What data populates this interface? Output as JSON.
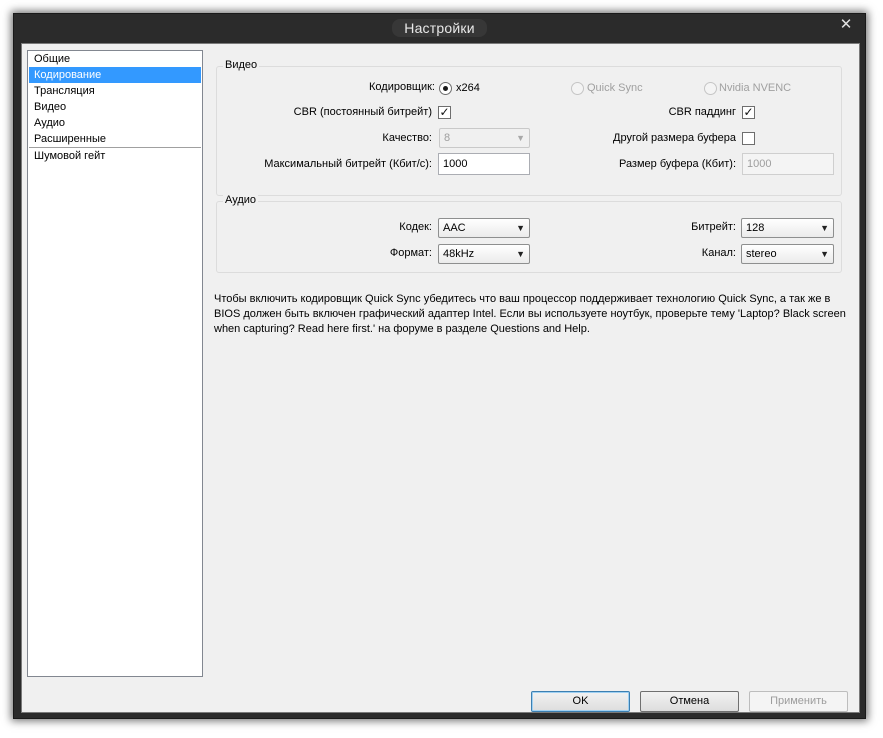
{
  "window": {
    "title": "Настройки"
  },
  "sidebar": {
    "items": [
      {
        "label": "Общие"
      },
      {
        "label": "Кодирование"
      },
      {
        "label": "Трансляция"
      },
      {
        "label": "Видео"
      },
      {
        "label": "Аудио"
      },
      {
        "label": "Расширенные"
      },
      {
        "label": "Шумовой гейт"
      }
    ],
    "selected": "Кодирование"
  },
  "video_group": {
    "title": "Видео",
    "encoder_label": "Кодировщик:",
    "encoder_options": [
      "x264",
      "Quick Sync",
      "Nvidia NVENC"
    ],
    "encoder_selected": "x264",
    "cbr_label": "CBR (постоянный битрейт)",
    "cbr_checked": true,
    "cbr_padding_label": "CBR паддинг",
    "cbr_padding_checked": true,
    "quality_label": "Качество:",
    "quality_value": "8",
    "custom_buffer_label": "Другой размера буфера",
    "custom_buffer_checked": false,
    "max_bitrate_label": "Максимальный битрейт (Кбит/с):",
    "max_bitrate_value": "1000",
    "buffer_size_label": "Размер буфера (Кбит):",
    "buffer_size_value": "1000"
  },
  "audio_group": {
    "title": "Аудио",
    "codec_label": "Кодек:",
    "codec_value": "AAC",
    "bitrate_label": "Битрейт:",
    "bitrate_value": "128",
    "format_label": "Формат:",
    "format_value": "48kHz",
    "channel_label": "Канал:",
    "channel_value": "stereo"
  },
  "info_text": "Чтобы включить кодировщик Quick Sync убедитесь что ваш процессор поддерживает технологию Quick Sync, а так же в BIOS должен быть включен графический адаптер Intel. Если вы используете ноутбук, проверьте тему 'Laptop? Black screen when capturing? Read here first.' на форуме в разделе Questions and Help.",
  "buttons": {
    "ok": "OK",
    "cancel": "Отмена",
    "apply": "Применить"
  },
  "icons": {
    "close": "close-icon",
    "dropdown": "chevron-down-icon",
    "check": "checkmark-icon"
  }
}
